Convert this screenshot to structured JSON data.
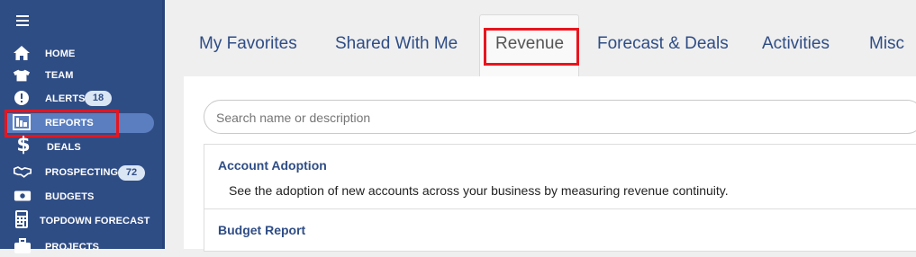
{
  "sidebar": {
    "menu_icon": "hamburger-icon",
    "items": [
      {
        "label": "HOME",
        "icon": "home-icon"
      },
      {
        "label": "TEAM",
        "icon": "shirt-icon"
      },
      {
        "label": "ALERTS",
        "icon": "alert-icon",
        "badge": "18"
      },
      {
        "label": "REPORTS",
        "icon": "chart-icon",
        "active": true
      },
      {
        "label": "DEALS",
        "icon": "dollar-icon"
      },
      {
        "label": "PROSPECTING",
        "icon": "handshake-icon",
        "badge": "72"
      },
      {
        "label": "BUDGETS",
        "icon": "money-icon"
      },
      {
        "label": "TOPDOWN FORECAST",
        "icon": "calculator-icon"
      },
      {
        "label": "PROJECTS",
        "icon": "briefcase-icon"
      }
    ]
  },
  "tabs": [
    {
      "label": "My Favorites"
    },
    {
      "label": "Shared With Me"
    },
    {
      "label": "Revenue",
      "active": true
    },
    {
      "label": "Forecast & Deals"
    },
    {
      "label": "Activities"
    },
    {
      "label": "Misc"
    }
  ],
  "search": {
    "placeholder": "Search name or description"
  },
  "reports": [
    {
      "title": "Account Adoption",
      "description": "See the adoption of new accounts across your business by measuring revenue continuity."
    },
    {
      "title": "Budget Report",
      "description": ""
    }
  ],
  "colors": {
    "sidebar": "#2f4d85",
    "accent": "#2f4d85",
    "highlight": "#e8141e",
    "badge_bg": "#dbe6f5"
  }
}
